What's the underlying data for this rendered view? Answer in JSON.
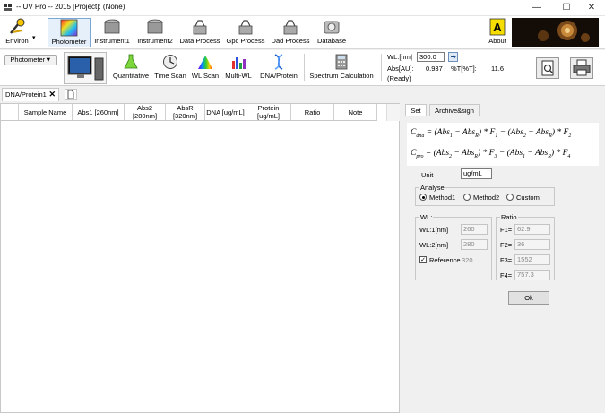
{
  "window": {
    "title": "-- UV Pro -- 2015 [Project]: (None)",
    "minimize_glyph": "—",
    "maximize_glyph": "☐",
    "close_glyph": "✕"
  },
  "main_toolbar": {
    "items": [
      {
        "label": "Environ",
        "icon": "environ-icon"
      },
      {
        "label": "Photometer",
        "icon": "photometer-icon",
        "active": true
      },
      {
        "label": "Instrument1",
        "icon": "instrument-icon"
      },
      {
        "label": "Instrument2",
        "icon": "instrument-icon"
      },
      {
        "label": "Data Process",
        "icon": "data-process-icon"
      },
      {
        "label": "Gpc Process",
        "icon": "gpc-process-icon"
      },
      {
        "label": "Dad Process",
        "icon": "dad-process-icon"
      },
      {
        "label": "Database",
        "icon": "database-icon"
      },
      {
        "label": "About",
        "icon": "about-icon"
      }
    ]
  },
  "sub_toolbar": {
    "mode_menu": "Photometer▼",
    "items": [
      {
        "label": "Quantitative",
        "icon": "flask-icon"
      },
      {
        "label": "Time Scan",
        "icon": "clock-icon"
      },
      {
        "label": "WL Scan",
        "icon": "spectrum-icon"
      },
      {
        "label": "Multi-WL",
        "icon": "multi-bar-icon"
      },
      {
        "label": "DNA/Protein",
        "icon": "dna-icon"
      },
      {
        "label": "Spectrum Calculation",
        "icon": "calculator-icon"
      }
    ],
    "readout": {
      "wl_label": "WL:[nm]",
      "wl_value": "300.0",
      "abs_label": "Abs[AU]:",
      "abs_value": "0.937",
      "t_label": "%T[%T]:",
      "t_value": "11.6",
      "status": "(Ready)"
    }
  },
  "document_tab": {
    "label": "DNA/Protein1"
  },
  "table": {
    "columns": [
      "Sample Name",
      "Abs1 [260nm]",
      "Abs2 [280nm]",
      "AbsR [320nm]",
      "DNA [ug/mL]",
      "Protein [ug/mL]",
      "Ratio",
      "Note"
    ],
    "rows": []
  },
  "panel": {
    "tabs": [
      "Set",
      "Archive&sign"
    ],
    "active_tab": "Set",
    "formula_dna": "C_dna = (Abs1 − AbsR) * F1 − (Abs2 − AbsR) * F2",
    "formula_pro": "C_pro = (Abs2 − AbsR) * F3 − (Abs1 − AbsR) * F4",
    "unit_label": "Unit",
    "unit_value": "ug/mL",
    "analyse": {
      "title": "Analyse",
      "options": [
        "Method1",
        "Method2",
        "Custom"
      ],
      "selected": "Method1"
    },
    "wl": {
      "title": "WL:",
      "wl1_label": "WL:1[nm]",
      "wl1_value": "260",
      "wl2_label": "WL:2[nm]",
      "wl2_value": "280",
      "reference_label": "Reference",
      "reference_checked": true,
      "reference_value": "320"
    },
    "ratio": {
      "title": "Ratio",
      "f1_label": "F1=",
      "f1_value": "62.9",
      "f2_label": "F2=",
      "f2_value": "36",
      "f3_label": "F3=",
      "f3_value": "1552",
      "f4_label": "F4=",
      "f4_value": "757.3"
    },
    "ok_label": "Ok"
  }
}
